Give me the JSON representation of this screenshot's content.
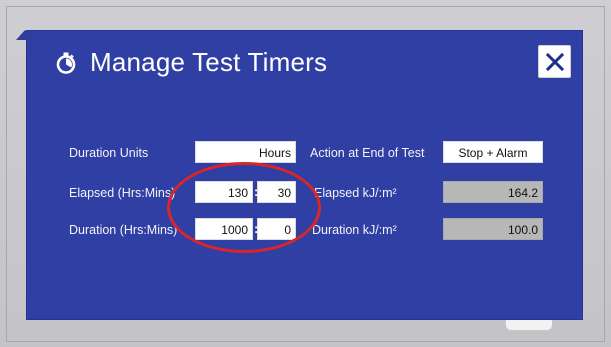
{
  "dialog": {
    "title": "Manage Test Timers",
    "icon": "stopwatch-icon",
    "close_icon": "close-icon"
  },
  "form": {
    "duration_units": {
      "label": "Duration Units",
      "value": "Hours"
    },
    "elapsed": {
      "label": "Elapsed (Hrs:Mins)",
      "hours": "130",
      "minutes": "30",
      "separator": ":"
    },
    "duration": {
      "label": "Duration (Hrs:Mins)",
      "hours": "1000",
      "minutes": "0",
      "separator": ":"
    },
    "action_end": {
      "label": "Action at End of Test",
      "value": "Stop + Alarm"
    },
    "elapsed_kj": {
      "label": "Elapsed kJ/:m²",
      "value": "164.2"
    },
    "duration_kj": {
      "label": "Duration kJ/:m²",
      "value": "100.0"
    }
  },
  "colors": {
    "dialog_bg": "#2f3fa3",
    "highlight": "#d8262a",
    "readonly_field": "#b7b7b7"
  }
}
